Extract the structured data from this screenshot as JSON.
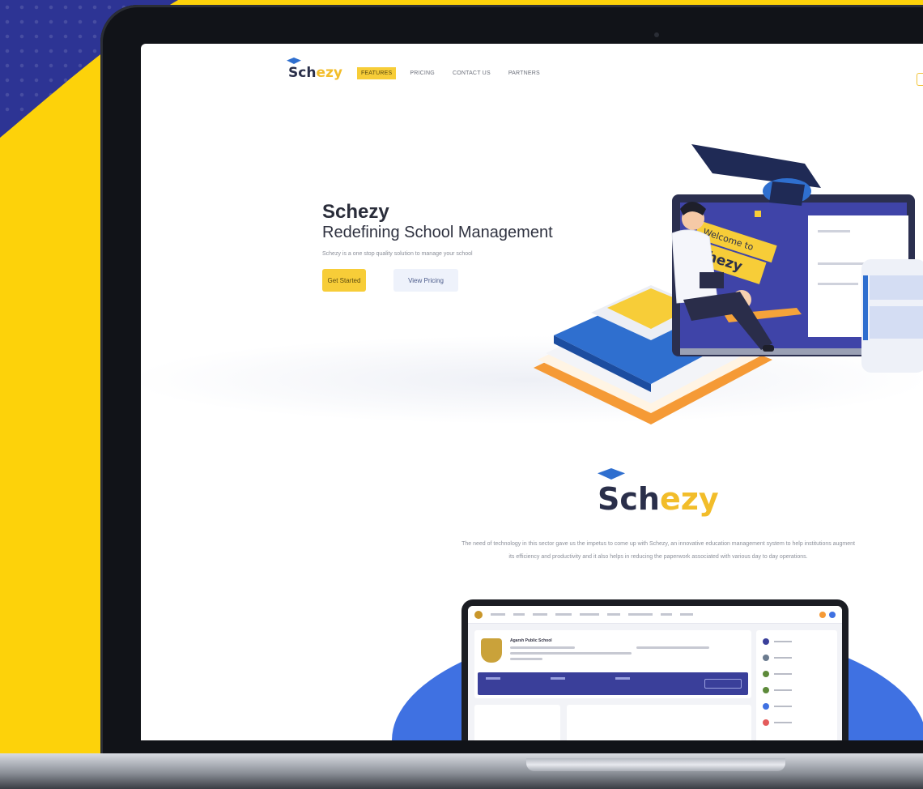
{
  "site": {
    "logo": {
      "part1": "Sch",
      "part2": "ezy"
    },
    "nav": [
      {
        "label": "FEATURES",
        "active": true
      },
      {
        "label": "PRICING",
        "active": false
      },
      {
        "label": "CONTACT US",
        "active": false
      },
      {
        "label": "PARTNERS",
        "active": false
      }
    ]
  },
  "hero": {
    "title": "Schezy",
    "subtitle": "Redefining School Management",
    "description": "Schezy is a one stop quality solution to manage your school",
    "primary_button": "Get Started",
    "secondary_button": "View Pricing",
    "illustration_welcome": "Welcome to",
    "illustration_brand": "Schezy"
  },
  "about": {
    "logo": {
      "part1": "Sch",
      "part2": "ezy"
    },
    "text": "The need of technology in this sector gave us the impetus to come up with Schezy, an innovative education management system to help institutions augment its efficiency and productivity and it also helps in reducing the paperwork associated with various day to day operations."
  },
  "dashboard": {
    "school_name": "Agarsh Public School"
  },
  "colors": {
    "brand_navy": "#2a2f4a",
    "brand_yellow": "#f2bd2a",
    "nav_active_bg": "#f7cd38",
    "background_blue": "#2d3494",
    "background_yellow": "#fdd20a",
    "blob_blue": "#3f71e2"
  }
}
